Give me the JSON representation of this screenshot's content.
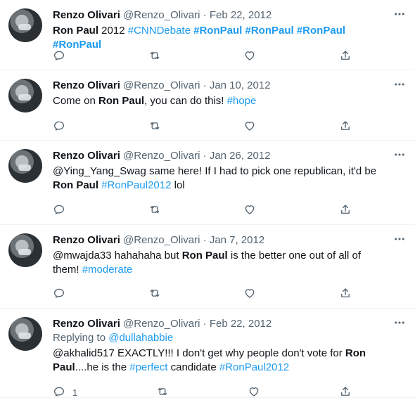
{
  "tweets": [
    {
      "name": "Renzo Olivari",
      "handle": "@Renzo_Olivari",
      "sep": "·",
      "date": "Feb 22, 2012",
      "replying_prefix": "",
      "replying_to": "",
      "text": [
        {
          "t": "Ron Paul",
          "s": "bold"
        },
        {
          "t": " 2012 ",
          "s": "plain"
        },
        {
          "t": "#CNNDebate",
          "s": "tag"
        },
        {
          "t": " ",
          "s": "plain"
        },
        {
          "t": "#RonPaul",
          "s": "tagbold"
        },
        {
          "t": " ",
          "s": "plain"
        },
        {
          "t": "#RonPaul",
          "s": "tagbold"
        },
        {
          "t": " ",
          "s": "plain"
        },
        {
          "t": "#RonPaul",
          "s": "tagbold"
        },
        {
          "t": " ",
          "s": "plain"
        },
        {
          "t": "#RonPaul",
          "s": "tagbold"
        }
      ],
      "reply_count": ""
    },
    {
      "name": "Renzo Olivari",
      "handle": "@Renzo_Olivari",
      "sep": "·",
      "date": "Jan 10, 2012",
      "replying_prefix": "",
      "replying_to": "",
      "text": [
        {
          "t": "Come on ",
          "s": "plain"
        },
        {
          "t": "Ron Paul",
          "s": "bold"
        },
        {
          "t": ", you can do this! ",
          "s": "plain"
        },
        {
          "t": "#hope",
          "s": "tag"
        }
      ],
      "reply_count": ""
    },
    {
      "name": "Renzo Olivari",
      "handle": "@Renzo_Olivari",
      "sep": "·",
      "date": "Jan 26, 2012",
      "replying_prefix": "",
      "replying_to": "",
      "text": [
        {
          "t": "@Ying_Yang_Swag same here! If I had to pick one republican, it'd be ",
          "s": "plain"
        },
        {
          "t": "Ron Paul",
          "s": "bold"
        },
        {
          "t": " ",
          "s": "plain"
        },
        {
          "t": "#RonPaul2012",
          "s": "tag"
        },
        {
          "t": " lol",
          "s": "plain"
        }
      ],
      "reply_count": ""
    },
    {
      "name": "Renzo Olivari",
      "handle": "@Renzo_Olivari",
      "sep": "·",
      "date": "Jan 7, 2012",
      "replying_prefix": "",
      "replying_to": "",
      "text": [
        {
          "t": "@mwajda33 hahahaha but ",
          "s": "plain"
        },
        {
          "t": "Ron Paul",
          "s": "bold"
        },
        {
          "t": " is the better one out of all of them! ",
          "s": "plain"
        },
        {
          "t": "#moderate",
          "s": "tag"
        }
      ],
      "reply_count": ""
    },
    {
      "name": "Renzo Olivari",
      "handle": "@Renzo_Olivari",
      "sep": "·",
      "date": "Feb 22, 2012",
      "replying_prefix": "Replying to ",
      "replying_to": "@dullahabbie",
      "text": [
        {
          "t": "@akhalid517 EXACTLY!!! I don't get why people don't vote for ",
          "s": "plain"
        },
        {
          "t": "Ron Paul",
          "s": "bold"
        },
        {
          "t": "....he is the ",
          "s": "plain"
        },
        {
          "t": "#perfect",
          "s": "tag"
        },
        {
          "t": " candidate ",
          "s": "plain"
        },
        {
          "t": "#RonPaul2012",
          "s": "tag"
        }
      ],
      "reply_count": "1"
    }
  ],
  "icons": {
    "more": "more-horizontal-icon",
    "reply": "reply-icon",
    "retweet": "retweet-icon",
    "like": "like-icon",
    "share": "share-icon"
  },
  "colors": {
    "link": "#1d9bf0",
    "secondary_text": "#536471",
    "primary_text": "#0f1419",
    "divider": "#eff3f4"
  }
}
